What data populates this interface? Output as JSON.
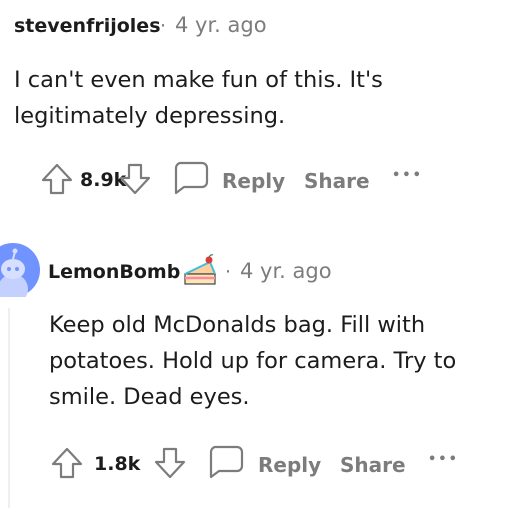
{
  "comments": [
    {
      "username": "stevenfrijoles",
      "separator": "·",
      "time": "4 yr. ago",
      "body": "I can't even make fun of this. It's legitimately depressing.",
      "score": "8.9k",
      "reply_label": "Reply",
      "share_label": "Share",
      "more_label": "•••"
    },
    {
      "username": "LemonBomb",
      "flair_icon": "cake-icon",
      "separator": "·",
      "time": "4 yr. ago",
      "body": "Keep old McDonalds bag. Fill with potatoes. Hold up for camera. Try to smile. Dead eyes.",
      "score": "1.8k",
      "reply_label": "Reply",
      "share_label": "Share",
      "more_label": "•••"
    }
  ],
  "colors": {
    "meta_gray": "#7c7c7c",
    "text_dark": "#1c1c1c",
    "avatar_blue": "#7193ff"
  }
}
